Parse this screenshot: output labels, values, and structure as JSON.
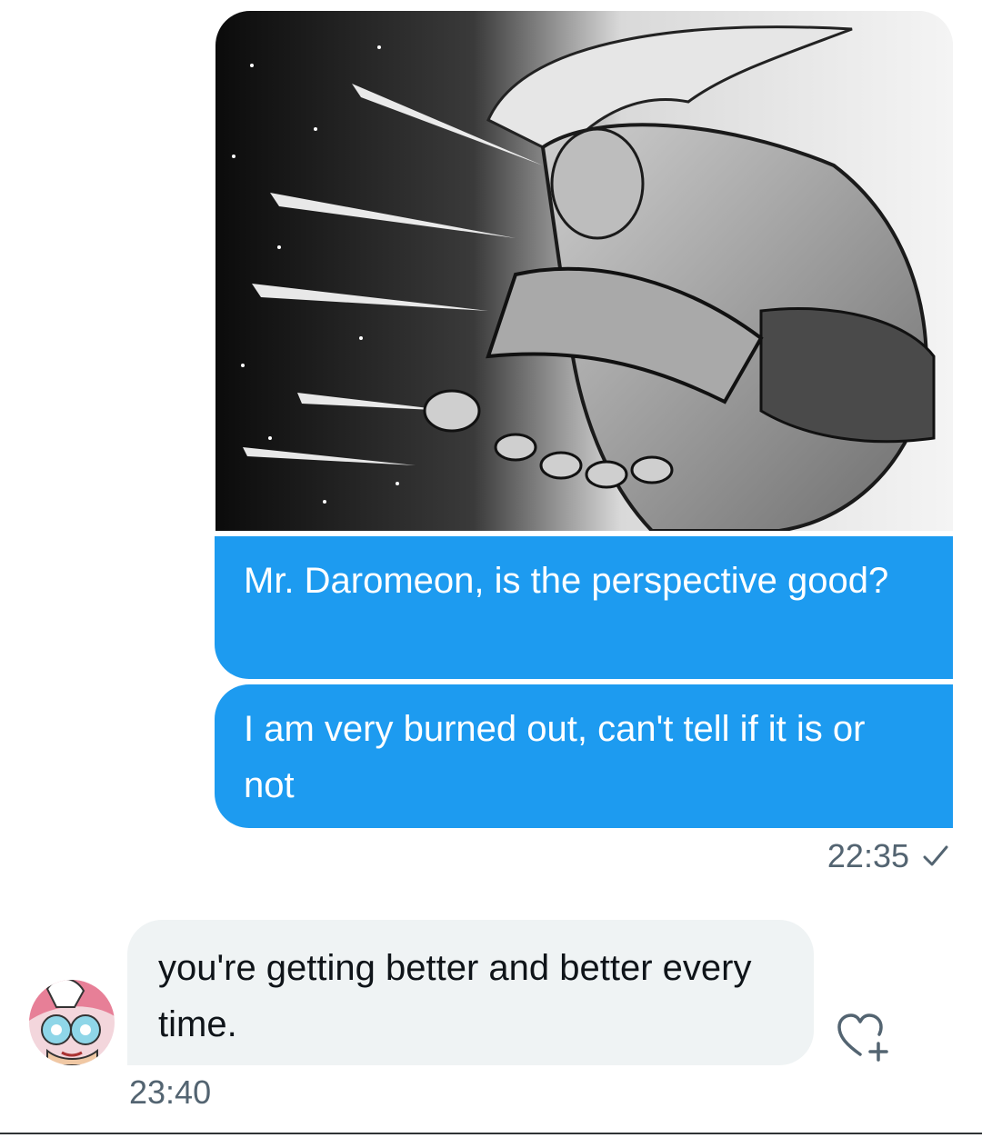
{
  "conversation": {
    "sent": {
      "image": {
        "description_icon": "manga-illustration-image"
      },
      "messages": [
        "Mr. Daromeon, is the perspective good?",
        "I am very burned out, can't tell if it is or not"
      ],
      "time": "22:35",
      "status_icon": "check-icon"
    },
    "received": {
      "avatar_icon": "avatar-image",
      "message": "you're getting better and better every time.",
      "time": "23:40",
      "react_icon": "heart-plus-icon"
    }
  },
  "colors": {
    "sent_bubble": "#1d9bf0",
    "received_bubble": "#eff3f4",
    "secondary_text": "#536471",
    "primary_text": "#0f1419"
  }
}
